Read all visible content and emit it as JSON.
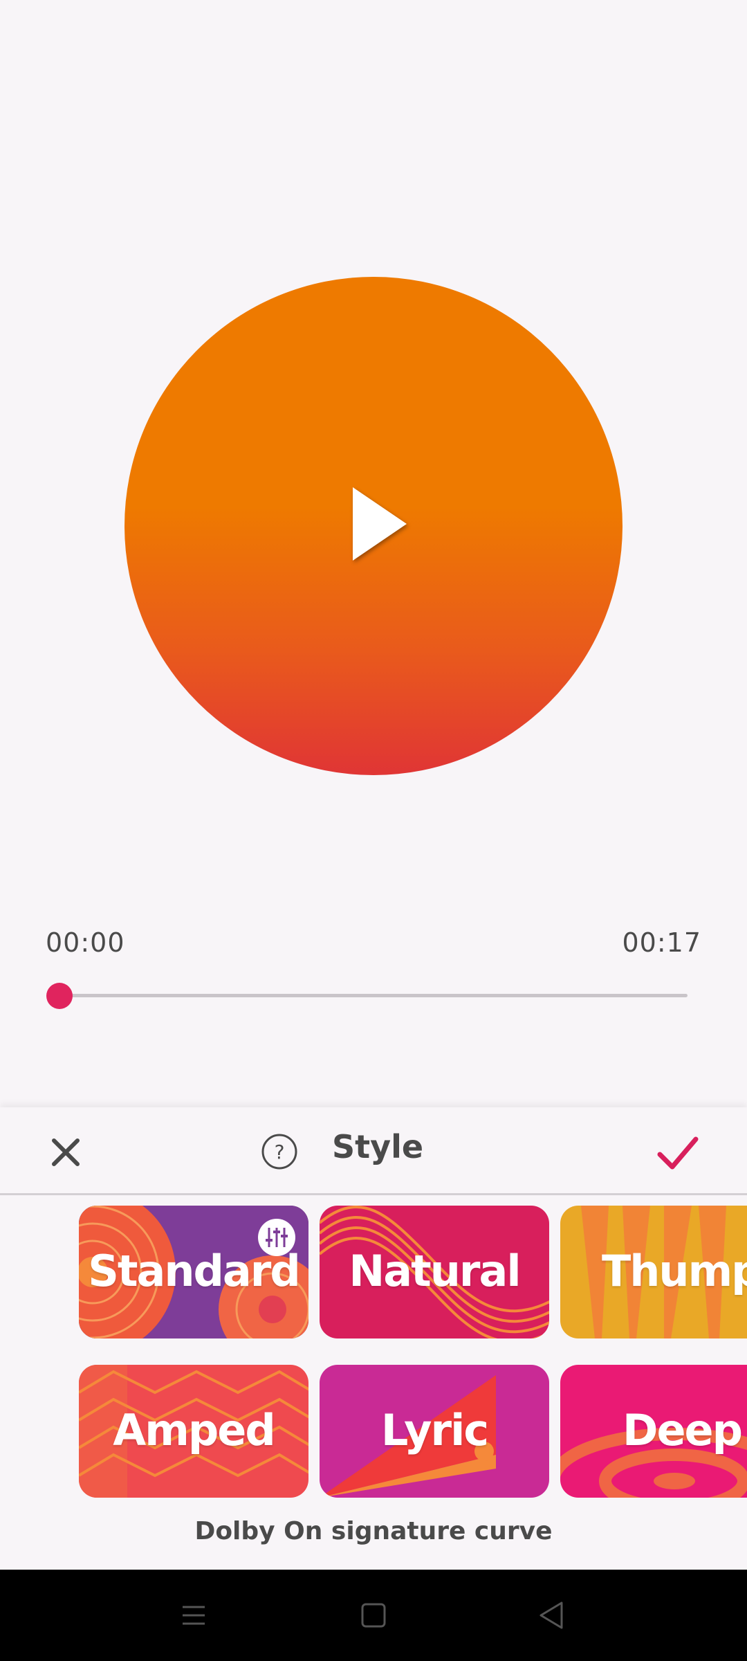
{
  "player": {
    "time_current": "00:00",
    "time_total": "00:17",
    "progress": 0,
    "play_icon": "play-icon",
    "accent_color": "#e0245e"
  },
  "sheet": {
    "title": "Style",
    "close_icon": "close-icon",
    "help_icon": "help-icon",
    "confirm_icon": "checkmark-icon",
    "caption": "Dolby On signature curve",
    "selected_style": "Standard",
    "styles": [
      {
        "label": "Standard",
        "color": "#7e3d98"
      },
      {
        "label": "Natural",
        "color": "#d81f5c"
      },
      {
        "label": "Thump",
        "color": "#e9a827"
      },
      {
        "label": "Amped",
        "color": "#ef4a4f"
      },
      {
        "label": "Lyric",
        "color": "#c92a95"
      },
      {
        "label": "Deep",
        "color": "#ea1a74"
      }
    ]
  },
  "nav": {
    "menu_icon": "menu-icon",
    "home_icon": "home-icon",
    "back_icon": "back-icon"
  }
}
